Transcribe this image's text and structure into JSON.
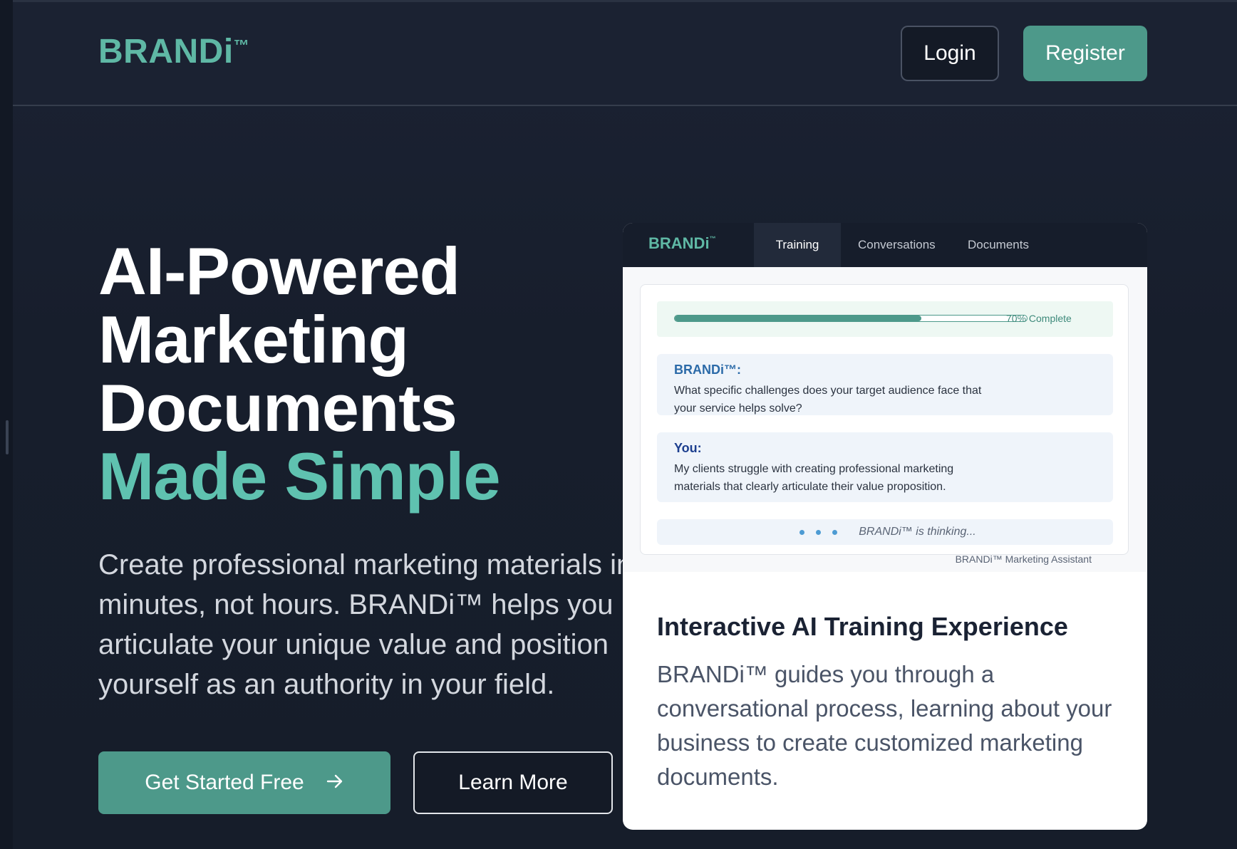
{
  "header": {
    "logo": "BRANDi",
    "logo_tm": "™",
    "login_label": "Login",
    "register_label": "Register"
  },
  "hero": {
    "title_lines": [
      "AI-Powered",
      "Marketing",
      "Documents"
    ],
    "title_accent": "Made Simple",
    "description": "Create professional marketing materials in minutes, not hours. BRANDi™ helps you articulate your unique value and position yourself as an authority in your field.",
    "primary_button": "Get Started Free",
    "primary_button_icon": "arrow-right-icon",
    "secondary_button": "Learn More"
  },
  "preview": {
    "logo": "BRANDi",
    "logo_tm": "™",
    "tabs": [
      {
        "label": "Training",
        "active": true
      },
      {
        "label": "Conversations",
        "active": false
      },
      {
        "label": "Documents",
        "active": false
      }
    ],
    "progress": {
      "value": 0.7,
      "label": "70% Complete"
    },
    "messages": [
      {
        "sender": "BRANDi™:",
        "text": "What specific challenges does your target audience face that your service helps solve?"
      },
      {
        "sender": "You:",
        "text": "My clients struggle with creating professional marketing materials that clearly articulate their value proposition."
      }
    ],
    "thinking_text": "BRANDi™ is thinking...",
    "assistant_label": "BRANDi™ Marketing Assistant"
  },
  "feature": {
    "title": "Interactive AI Training Experience",
    "description": "BRANDi™ guides you through a conversational process, learning about your business to create customized marketing documents."
  },
  "colors": {
    "accent": "#5fc2b0",
    "button_teal": "#4d998a",
    "background": "#161d2b"
  }
}
